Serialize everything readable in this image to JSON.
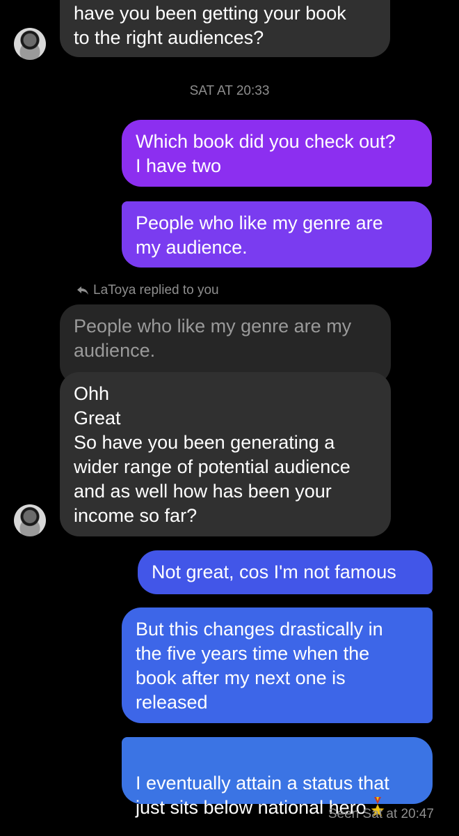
{
  "messages": {
    "m1": "have you been getting your book\nto the right audiences?",
    "m2": "Which book did you check out?\nI have two",
    "m3": "People who like my genre are\nmy audience.",
    "quoted": "People who like my genre are my\naudience.",
    "m4": "Ohh\nGreat\nSo have you been generating a\nwider range of potential audience\nand as well how has been your\nincome so far?",
    "m5": "Not great, cos I'm not famous",
    "m6": "But this changes drastically in\nthe five years time when the\nbook after my next one is\nreleased",
    "m7": "I eventually attain a status that\njust sits below national hero"
  },
  "timestamp": "SAT AT 20:33",
  "reply_note": "LaToya replied to you",
  "seen": "Seen Sat at 20:47",
  "icons": {
    "reply": "reply-arrow-icon",
    "medal": "military-medal-emoji"
  },
  "colors": {
    "background": "#000000",
    "incoming_bubble": "#303030",
    "outgoing_purple": "#8a2be2",
    "outgoing_blue": "#3d6ee0",
    "meta_text": "#8e8e8e"
  }
}
